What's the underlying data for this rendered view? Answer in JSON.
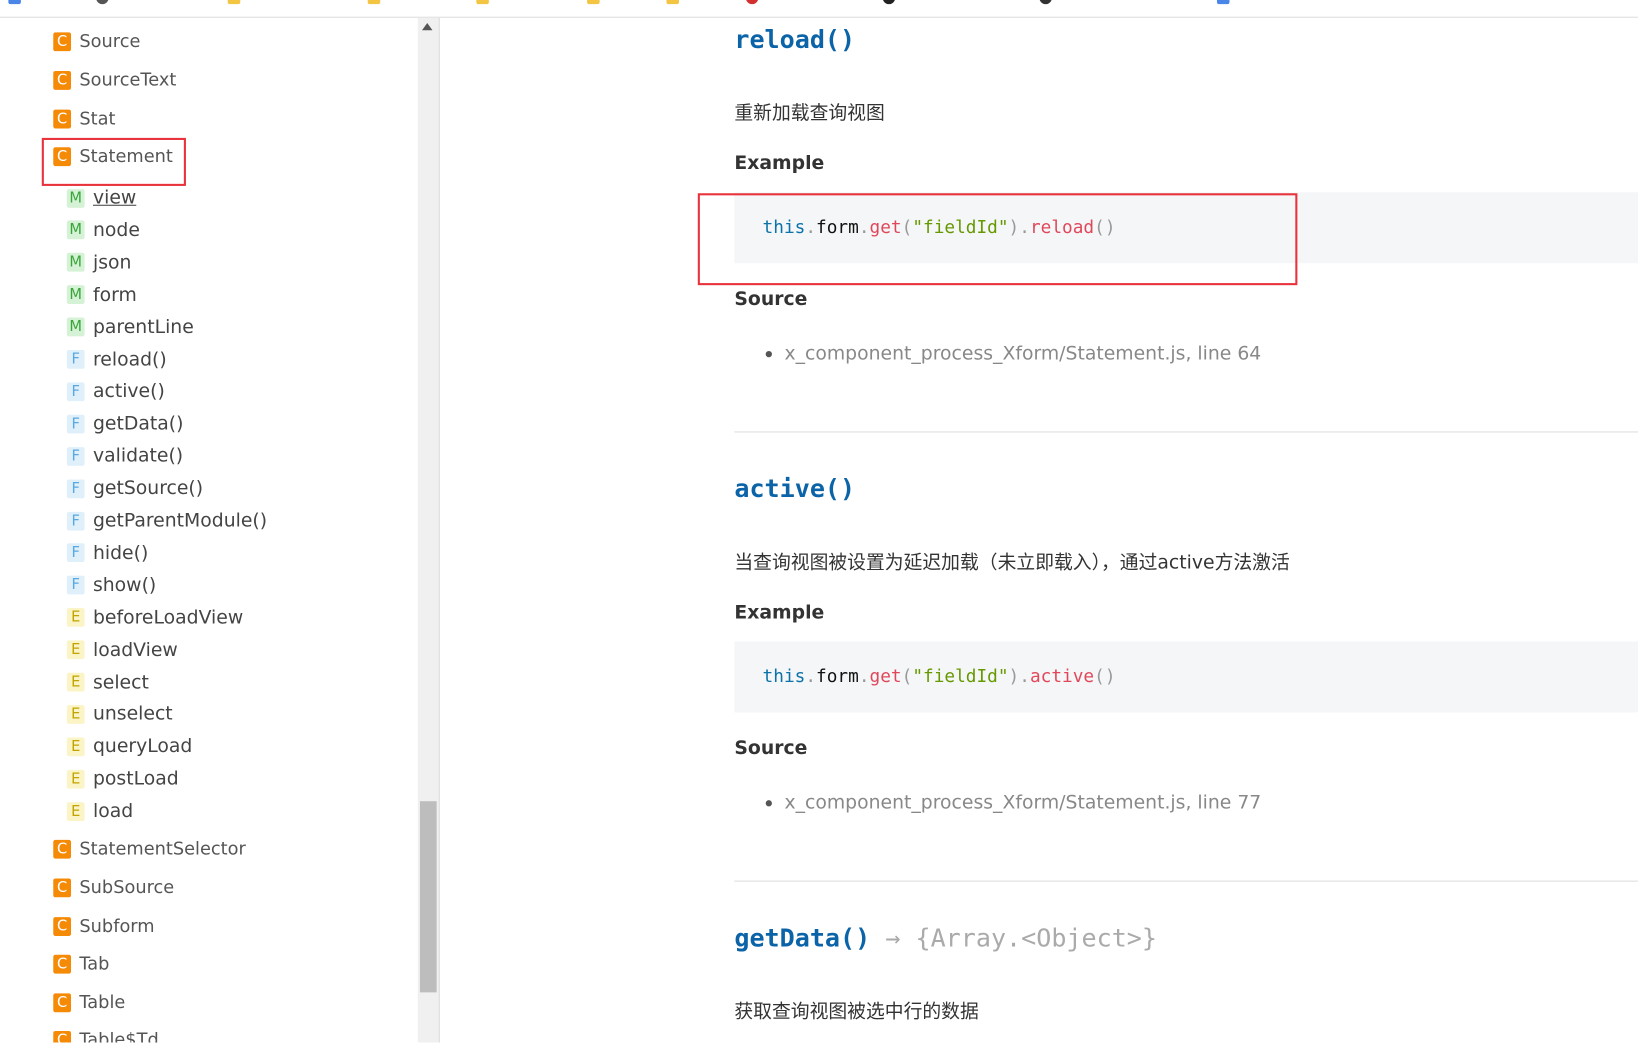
{
  "sidebar": {
    "classes_before": [
      {
        "badge": "C",
        "label": "Source"
      },
      {
        "badge": "C",
        "label": "SourceText"
      },
      {
        "badge": "C",
        "label": "Stat"
      },
      {
        "badge": "C",
        "label": "Statement"
      }
    ],
    "members": [
      {
        "badge": "M",
        "label": "view"
      },
      {
        "badge": "M",
        "label": "node"
      },
      {
        "badge": "M",
        "label": "json"
      },
      {
        "badge": "M",
        "label": "form"
      },
      {
        "badge": "M",
        "label": "parentLine"
      },
      {
        "badge": "F",
        "label": "reload()"
      },
      {
        "badge": "F",
        "label": "active()"
      },
      {
        "badge": "F",
        "label": "getData()"
      },
      {
        "badge": "F",
        "label": "validate()"
      },
      {
        "badge": "F",
        "label": "getSource()"
      },
      {
        "badge": "F",
        "label": "getParentModule()"
      },
      {
        "badge": "F",
        "label": "hide()"
      },
      {
        "badge": "F",
        "label": "show()"
      },
      {
        "badge": "E",
        "label": "beforeLoadView"
      },
      {
        "badge": "E",
        "label": "loadView"
      },
      {
        "badge": "E",
        "label": "select"
      },
      {
        "badge": "E",
        "label": "unselect"
      },
      {
        "badge": "E",
        "label": "queryLoad"
      },
      {
        "badge": "E",
        "label": "postLoad"
      },
      {
        "badge": "E",
        "label": "load"
      }
    ],
    "classes_after": [
      {
        "badge": "C",
        "label": "StatementSelector"
      },
      {
        "badge": "C",
        "label": "SubSource"
      },
      {
        "badge": "C",
        "label": "Subform"
      },
      {
        "badge": "C",
        "label": "Tab"
      },
      {
        "badge": "C",
        "label": "Table"
      },
      {
        "badge": "C",
        "label": "Table$Td"
      }
    ]
  },
  "content": {
    "reload": {
      "title": "reload()",
      "description": "重新加载查询视图",
      "example_label": "Example",
      "code": {
        "this": "this",
        "dot1": ".",
        "form": "form",
        "dot2": ".",
        "get": "get",
        "lp": "(",
        "str": "\"fieldId\"",
        "rp": ")",
        "dot3": ".",
        "method": "reload",
        "parens": "()"
      },
      "source_label": "Source",
      "source": "x_component_process_Xform/Statement.js, line 64"
    },
    "active": {
      "title": "active()",
      "description": "当查询视图被设置为延迟加载（未立即载入），通过active方法激活",
      "example_label": "Example",
      "code": {
        "this": "this",
        "dot1": ".",
        "form": "form",
        "dot2": ".",
        "get": "get",
        "lp": "(",
        "str": "\"fieldId\"",
        "rp": ")",
        "dot3": ".",
        "method": "active",
        "parens": "()"
      },
      "source_label": "Source",
      "source": "x_component_process_Xform/Statement.js, line 77"
    },
    "getData": {
      "title": "getData()",
      "returns": "→ {Array.<Object>}",
      "description": "获取查询视图被选中行的数据"
    }
  },
  "colors": {
    "accent": "#0b63a8",
    "highlight_box": "#e8323c",
    "class_badge": "#f58a07"
  }
}
